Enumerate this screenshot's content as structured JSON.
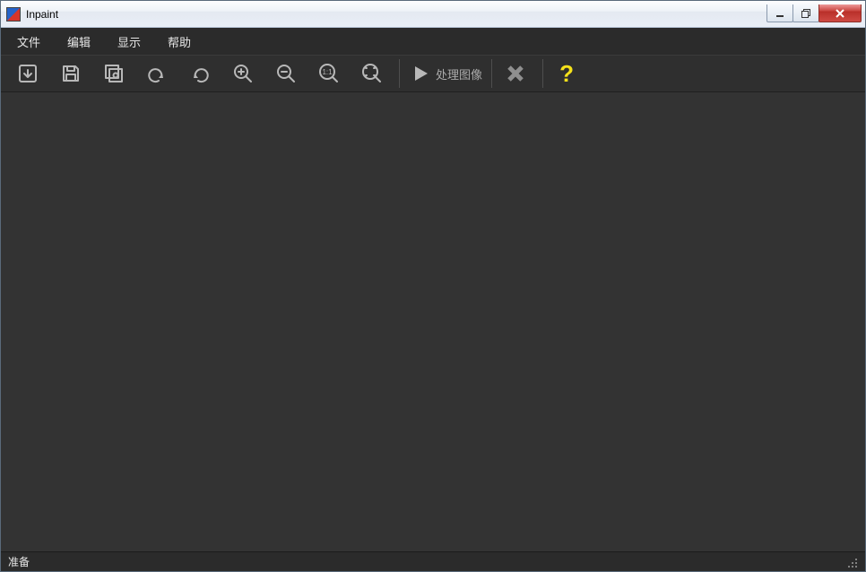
{
  "window": {
    "title": "Inpaint"
  },
  "menu": {
    "file": "文件",
    "edit": "编辑",
    "view": "显示",
    "help": "帮助"
  },
  "toolbar": {
    "process_label": "处理图像",
    "help_label": "?"
  },
  "status": {
    "text": "准备"
  }
}
